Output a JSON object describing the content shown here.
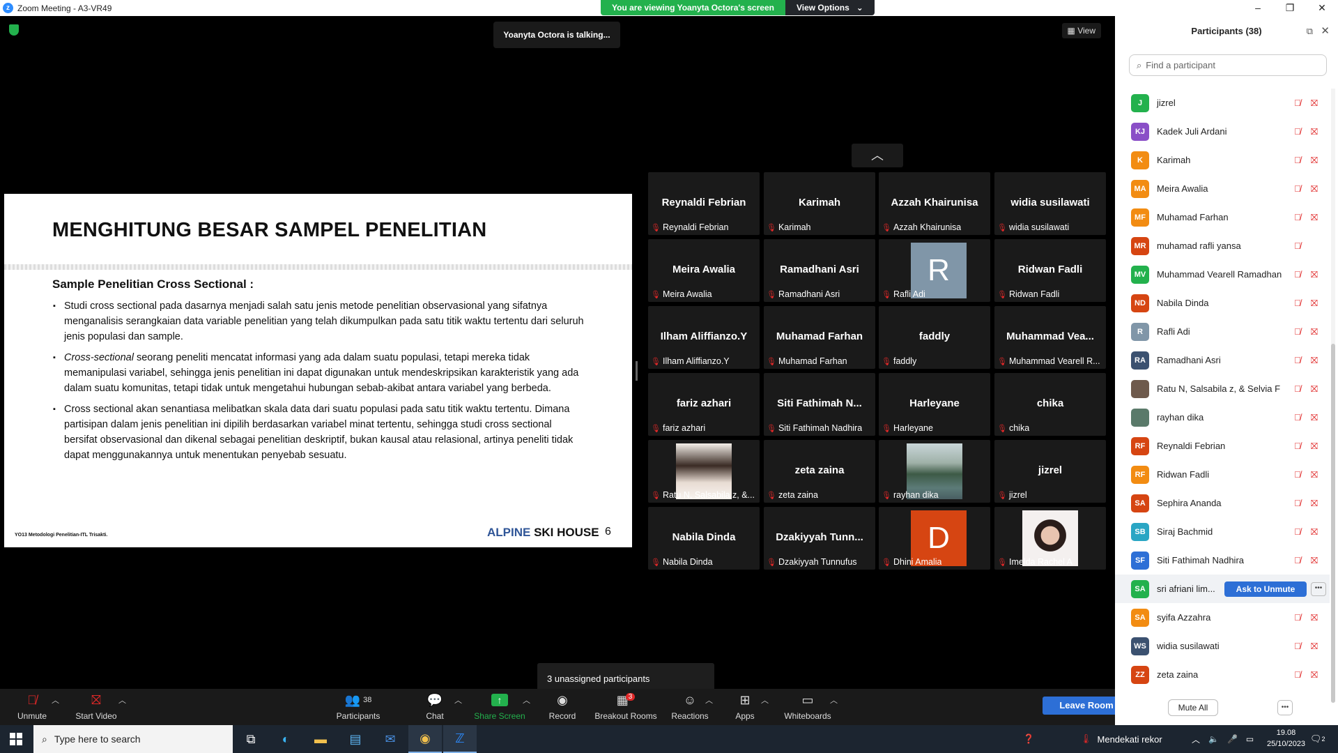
{
  "window": {
    "title": "Zoom Meeting - A3-VR49",
    "viewing_banner": "You are viewing Yoanyta Octora's screen",
    "view_options": "View Options",
    "controls": [
      "–",
      "❐",
      "✕"
    ]
  },
  "meeting": {
    "talking": "Yoanyta Octora is talking...",
    "view_label": "View"
  },
  "slide": {
    "heading": "MENGHITUNG BESAR SAMPEL PENELITIAN",
    "subheading": "Sample Penelitian Cross Sectional :",
    "bullet1": "Studi cross sectional pada dasarnya menjadi salah satu jenis metode penelitian observasional yang sifatnya menganalisis serangkaian data variable penelitian yang telah dikumpulkan pada satu titik waktu tertentu dari seluruh jenis populasi dan sample.",
    "bullet2_italic": "Cross-sectional",
    "bullet2": " seorang peneliti mencatat informasi yang ada dalam suatu populasi, tetapi mereka tidak memanipulasi variabel, sehingga jenis penelitian ini dapat digunakan untuk mendeskripsikan karakteristik yang ada dalam suatu komunitas, tetapi tidak untuk mengetahui hubungan sebab-akibat antara variabel yang berbeda.",
    "bullet3": "Cross sectional akan senantiasa melibatkan skala data dari suatu populasi pada satu titik waktu tertentu. Dimana partisipan dalam jenis penelitian ini dipilih berdasarkan variabel minat tertentu, sehingga studi cross sectional bersifat observasional dan dikenal sebagai penelitian deskriptif, bukan kausal atau relasional, artinya peneliti tidak dapat menggunakannya untuk menentukan penyebab sesuatu.",
    "footer": "YO13 Metodologi Penelitian-ITL Trisakti.",
    "brand_part1": "ALPINE",
    "brand_part2": " SKI HOUSE",
    "page_number": "6"
  },
  "tiles": [
    {
      "big": "Reynaldi Febrian",
      "label": "Reynaldi Febrian"
    },
    {
      "big": "Karimah",
      "label": "Karimah"
    },
    {
      "big": "Azzah Khairunisa",
      "label": "Azzah Khairunisa"
    },
    {
      "big": "widia susilawati",
      "label": "widia susilawati"
    },
    {
      "big": "Meira Awalia",
      "label": "Meira Awalia"
    },
    {
      "big": "Ramadhani Asri",
      "label": "Ramadhani Asri"
    },
    {
      "big": "",
      "label": "Rafli Adi",
      "letter": "R",
      "color": "#8096a8"
    },
    {
      "big": "Ridwan Fadli",
      "label": "Ridwan Fadli"
    },
    {
      "big": "Ilham Aliffianzo.Y",
      "label": "Ilham Aliffianzo.Y"
    },
    {
      "big": "Muhamad Farhan",
      "label": "Muhamad Farhan"
    },
    {
      "big": "faddly",
      "label": "faddly"
    },
    {
      "big": "Muhammad Vea...",
      "label": "Muhammad Vearell R..."
    },
    {
      "big": "fariz azhari",
      "label": "fariz azhari"
    },
    {
      "big": "Siti Fathimah N...",
      "label": "Siti Fathimah Nadhira"
    },
    {
      "big": "Harleyane",
      "label": "Harleyane"
    },
    {
      "big": "chika",
      "label": "chika"
    },
    {
      "big": "",
      "label": "Ratu N, Salsabila z, &...",
      "photo": "portrait"
    },
    {
      "big": "zeta zaina",
      "label": "zeta zaina"
    },
    {
      "big": "",
      "label": "rayhan dika",
      "photo": "landscape"
    },
    {
      "big": "jizrel",
      "label": "jizrel"
    },
    {
      "big": "Nabila Dinda",
      "label": "Nabila Dinda"
    },
    {
      "big": "Dzakiyyah Tunn...",
      "label": "Dzakiyyah Tunnufus"
    },
    {
      "big": "",
      "label": "Dhini Amalia",
      "letter": "D",
      "color": "#d64512"
    },
    {
      "big": "",
      "label": "Imelda Rachel A",
      "photo": "selfie"
    }
  ],
  "unassigned_tooltip": "3 unassigned participants",
  "toolbar": {
    "unmute": "Unmute",
    "start_video": "Start Video",
    "participants": "Participants",
    "participants_count": "38",
    "chat": "Chat",
    "share_screen": "Share Screen",
    "record": "Record",
    "breakout_rooms": "Breakout Rooms",
    "breakout_badge": "3",
    "reactions": "Reactions",
    "apps": "Apps",
    "whiteboards": "Whiteboards",
    "leave_room": "Leave Room"
  },
  "panel": {
    "title": "Participants (38)",
    "search_placeholder": "Find a participant",
    "mute_all": "Mute All",
    "participants": [
      {
        "initials": "J",
        "name": "jizrel",
        "color": "#23b14d"
      },
      {
        "initials": "KJ",
        "name": "Kadek Juli Ardani",
        "color": "#8a4fc7"
      },
      {
        "initials": "K",
        "name": "Karimah",
        "color": "#f28c12"
      },
      {
        "initials": "MA",
        "name": "Meira Awalia",
        "color": "#f28c12"
      },
      {
        "initials": "MF",
        "name": "Muhamad Farhan",
        "color": "#f28c12"
      },
      {
        "initials": "MR",
        "name": "muhamad rafli yansa",
        "color": "#d64512"
      },
      {
        "initials": "MV",
        "name": "Muhammad Vearell Ramadhan",
        "color": "#23b14d"
      },
      {
        "initials": "ND",
        "name": "Nabila Dinda",
        "color": "#d64512"
      },
      {
        "initials": "R",
        "name": "Rafli Adi",
        "color": "#8096a8"
      },
      {
        "initials": "RA",
        "name": "Ramadhani Asri",
        "color": "#3b5170"
      },
      {
        "initials": "",
        "name": "Ratu N, Salsabila z, & Selvia F",
        "color": "#6e5a4c"
      },
      {
        "initials": "",
        "name": "rayhan dika",
        "color": "#5a7a6a"
      },
      {
        "initials": "RF",
        "name": "Reynaldi Febrian",
        "color": "#d64512"
      },
      {
        "initials": "RF",
        "name": "Ridwan Fadli",
        "color": "#f28c12"
      },
      {
        "initials": "SA",
        "name": "Sephira Ananda",
        "color": "#d64512"
      },
      {
        "initials": "SB",
        "name": "Siraj Bachmid",
        "color": "#2aa6c4"
      },
      {
        "initials": "SF",
        "name": "Siti Fathimah Nadhira",
        "color": "#2d6fd6"
      },
      {
        "initials": "SA",
        "name": "sri afriani lim...",
        "color": "#23b14d",
        "ask": "Ask to Unmute"
      },
      {
        "initials": "SA",
        "name": "syifa Azzahra",
        "color": "#f28c12"
      },
      {
        "initials": "WS",
        "name": "widia susilawati",
        "color": "#3b5170"
      },
      {
        "initials": "ZZ",
        "name": "zeta zaina",
        "color": "#d64512"
      }
    ]
  },
  "taskbar": {
    "search_placeholder": "Type here to search",
    "weather": "Mendekati rekor",
    "time": "19.08",
    "date": "25/10/2023",
    "notifications": "2"
  }
}
